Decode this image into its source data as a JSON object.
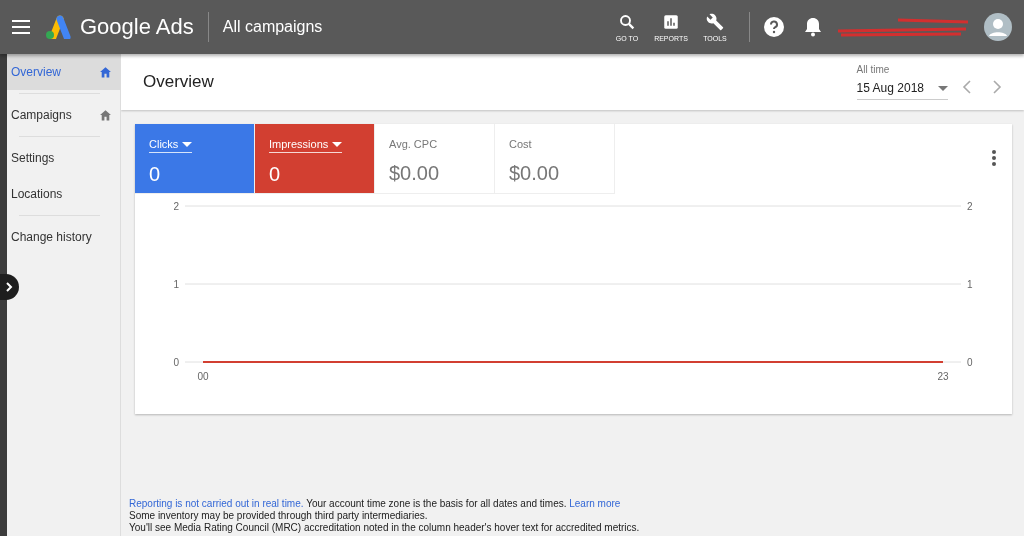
{
  "topbar": {
    "product": "Google Ads",
    "scope": "All campaigns",
    "tools": [
      {
        "kind": "search",
        "label": "GO TO"
      },
      {
        "kind": "reports",
        "label": "REPORTS"
      },
      {
        "kind": "tools",
        "label": "TOOLS"
      }
    ]
  },
  "sidebar": {
    "groups": [
      [
        {
          "label": "Overview",
          "kind": "home",
          "selected": true
        }
      ],
      [
        {
          "label": "Campaigns",
          "kind": "home",
          "selected": false
        }
      ],
      [
        {
          "label": "Settings",
          "kind": "plain",
          "selected": false
        },
        {
          "label": "Locations",
          "kind": "plain",
          "selected": false
        }
      ],
      [
        {
          "label": "Change history",
          "kind": "plain",
          "selected": false
        }
      ]
    ]
  },
  "header": {
    "title": "Overview",
    "range_label": "All time",
    "date": "15 Aug 2018"
  },
  "metrics": [
    {
      "label": "Clicks",
      "value": "0",
      "selected": true,
      "color": "#3b78e7"
    },
    {
      "label": "Impressions",
      "value": "0",
      "selected": true,
      "color": "#d23f31"
    },
    {
      "label": "Avg. CPC",
      "value": "$0.00",
      "selected": false,
      "color": "#ffffff"
    },
    {
      "label": "Cost",
      "value": "$0.00",
      "selected": false,
      "color": "#ffffff"
    }
  ],
  "chart": {
    "right_axis_labels": [
      "2",
      "1",
      "0"
    ],
    "chart_data": {
      "type": "line",
      "x": [
        0,
        23
      ],
      "series": [
        {
          "color": "#d23f31",
          "values": [
            0,
            0
          ]
        }
      ],
      "xlim": [
        0,
        23
      ],
      "ylim": [
        0,
        2
      ],
      "yticks": [
        0,
        1,
        2
      ],
      "xticks": [
        {
          "value": 0,
          "label": "00"
        },
        {
          "value": 23,
          "label": "23"
        }
      ]
    }
  },
  "footer": [
    [
      {
        "kind": "link",
        "text": "Reporting is not carried out in real time."
      },
      {
        "kind": "text",
        "text": "Your account time zone is the basis for all dates and times."
      },
      {
        "kind": "link",
        "text": "Learn more"
      }
    ],
    [
      {
        "kind": "text",
        "text": "Some inventory may be provided through third party intermediaries."
      }
    ],
    [
      {
        "kind": "text",
        "text": "You'll see Media Rating Council (MRC) accreditation noted in the column header's hover text for accredited metrics."
      }
    ]
  ]
}
